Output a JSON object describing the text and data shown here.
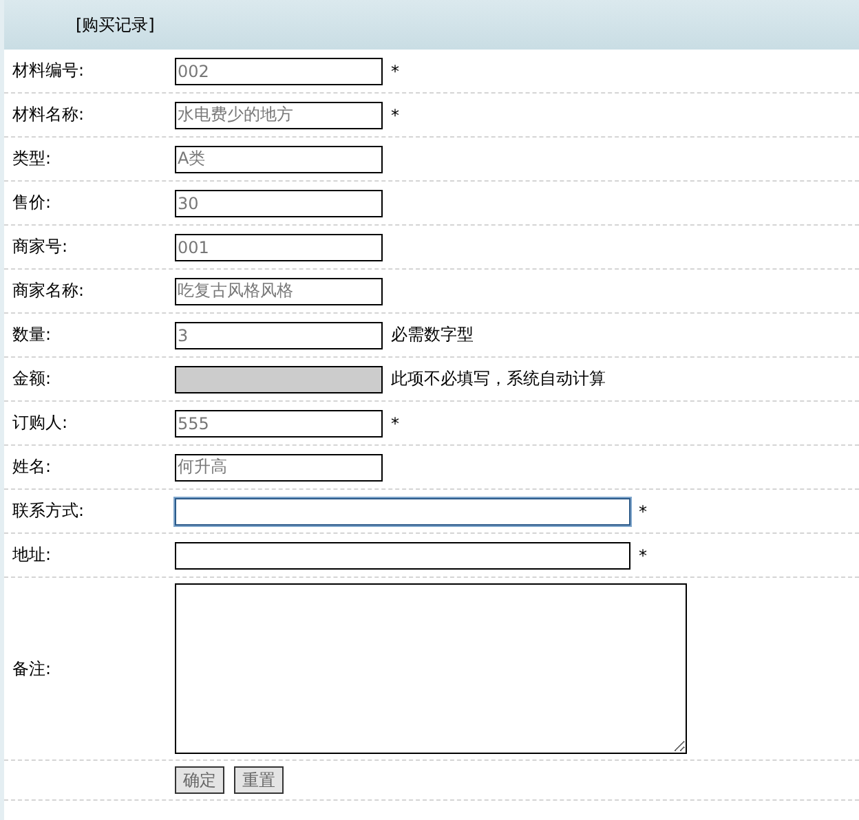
{
  "header": {
    "title": "[购买记录]"
  },
  "rows": [
    {
      "label": "材料编号:",
      "kind": "short",
      "value": "002",
      "note": "*",
      "disabled": false,
      "focused": false
    },
    {
      "label": "材料名称:",
      "kind": "short",
      "value": "水电费少的地方",
      "note": "*",
      "disabled": false,
      "focused": false
    },
    {
      "label": "类型:",
      "kind": "short",
      "value": "A类",
      "disabled": false,
      "focused": false
    },
    {
      "label": "售价:",
      "kind": "short",
      "value": "30",
      "disabled": false,
      "focused": false
    },
    {
      "label": "商家号:",
      "kind": "short",
      "value": "001",
      "disabled": false,
      "focused": false
    },
    {
      "label": "商家名称:",
      "kind": "short",
      "value": "吃复古风格风格",
      "disabled": false,
      "focused": false
    },
    {
      "label": "数量:",
      "kind": "short",
      "value": "3",
      "note": "必需数字型",
      "disabled": false,
      "focused": false
    },
    {
      "label": "金额:",
      "kind": "short",
      "note": "此项不必填写，系统自动计算",
      "disabled": true,
      "focused": false
    },
    {
      "label": "订购人:",
      "kind": "short",
      "value": "555",
      "note": "*",
      "disabled": false,
      "focused": false
    },
    {
      "label": "姓名:",
      "kind": "short",
      "value": "何升高",
      "disabled": false,
      "focused": false
    },
    {
      "label": "联系方式:",
      "kind": "long",
      "note": "*",
      "disabled": false,
      "focused": true
    },
    {
      "label": "地址:",
      "kind": "long",
      "note": "*",
      "disabled": false,
      "focused": false
    },
    {
      "label": "备注:",
      "kind": "textarea"
    }
  ],
  "buttons": [
    "确定",
    "重置"
  ]
}
